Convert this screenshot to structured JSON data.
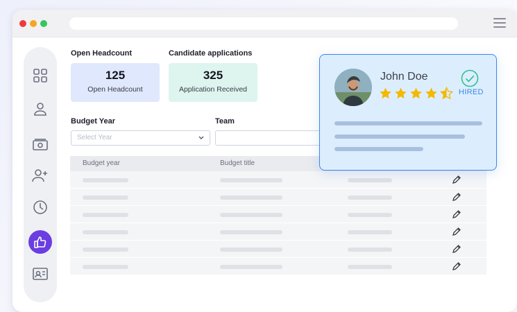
{
  "colors": {
    "accent": "#6a3ee0",
    "highlight": "#3d86e6",
    "star": "#f5b800"
  },
  "window": {
    "traffic_lights": [
      "red",
      "yellow",
      "green"
    ]
  },
  "sidebar": {
    "items": [
      {
        "icon": "grid-icon",
        "active": false
      },
      {
        "icon": "user-icon",
        "active": false
      },
      {
        "icon": "cash-icon",
        "active": false
      },
      {
        "icon": "add-user-icon",
        "active": false
      },
      {
        "icon": "clock-icon",
        "active": false
      },
      {
        "icon": "thumbs-up-icon",
        "active": true
      },
      {
        "icon": "id-card-icon",
        "active": false
      }
    ]
  },
  "stats": {
    "open_headcount": {
      "title": "Open Headcount",
      "value": "125",
      "label": "Open Headcount"
    },
    "applications": {
      "title": "Candidate applications",
      "value": "325",
      "label": "Application Received"
    }
  },
  "filters": {
    "budget_year": {
      "label": "Budget Year",
      "placeholder": "Select Year"
    },
    "team": {
      "label": "Team"
    }
  },
  "table": {
    "columns": [
      "Budget year",
      "Budget title",
      ""
    ],
    "row_count": 6
  },
  "profile_card": {
    "name": "John Doe",
    "rating": 4.5,
    "rating_max": 5,
    "status": "HIRED"
  }
}
